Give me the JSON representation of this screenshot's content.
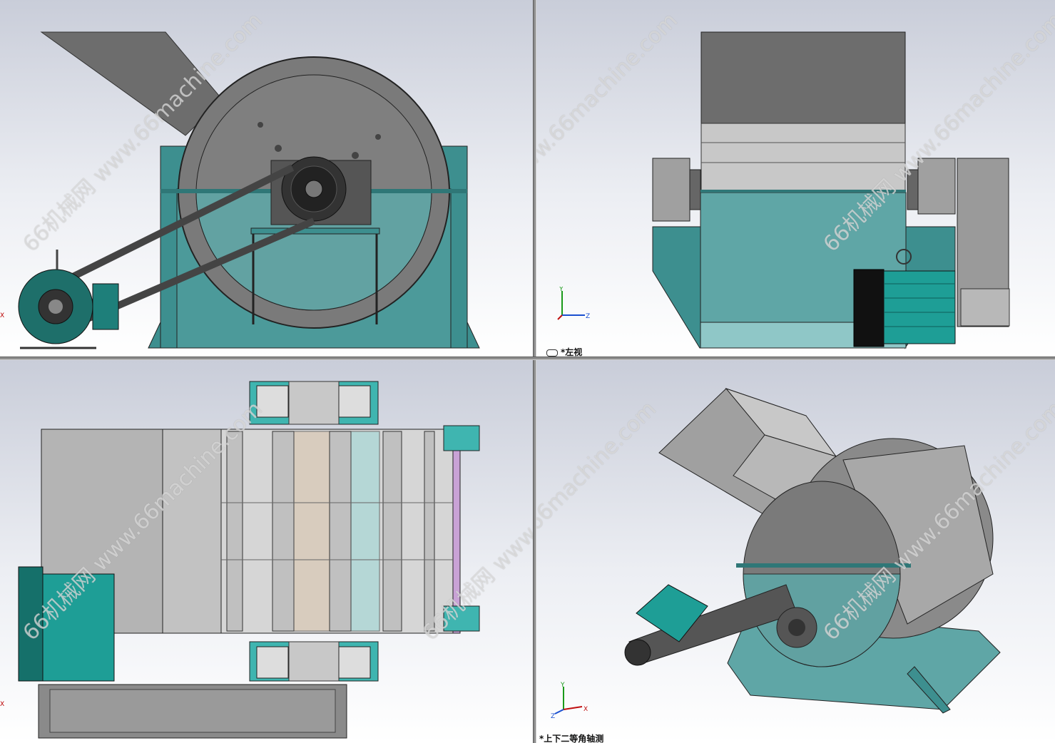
{
  "views": {
    "top_left": {
      "label": ""
    },
    "top_right": {
      "label": "*左视"
    },
    "bottom_left": {
      "label": ""
    },
    "bottom_right": {
      "label": "*上下二等角轴测"
    }
  },
  "watermark": {
    "text": "66机械网 www.66machine.com"
  },
  "triad": {
    "x": "X",
    "y": "Y",
    "z": "Z"
  },
  "colors": {
    "teal": "#3d8f8f",
    "teal_light": "#8fc7c7",
    "gray_dark": "#6d6d6d",
    "gray": "#a6a6a6",
    "gray_light": "#d4d4d4",
    "motor_teal": "#1e9e96",
    "background_top": "#c9cdd9"
  }
}
